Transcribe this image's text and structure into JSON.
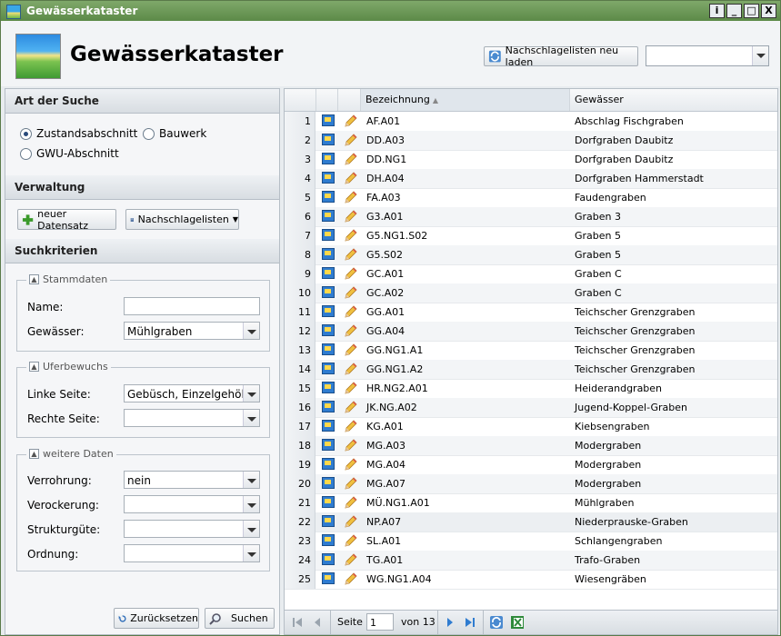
{
  "window": {
    "title": "Gewässerkataster",
    "btn_info": "i",
    "btn_min": "_",
    "btn_max": "□",
    "btn_close": "X"
  },
  "header": {
    "title": "Gewässerkataster",
    "reload_label": "Nachschlagelisten neu laden",
    "combo_value": ""
  },
  "search_type": {
    "title": "Art der Suche",
    "options": [
      "Zustandsabschnitt",
      "Bauwerk",
      "GWU-Abschnitt"
    ],
    "selected": "Zustandsabschnitt"
  },
  "verwaltung": {
    "title": "Verwaltung",
    "new_label": "neuer Datensatz",
    "lists_label": "Nachschlagelisten"
  },
  "criteria": {
    "title": "Suchkriterien",
    "stammdaten": {
      "legend": "Stammdaten",
      "name_label": "Name:",
      "name_value": "",
      "gewaesser_label": "Gewässer:",
      "gewaesser_value": "Mühlgraben"
    },
    "uferbewuchs": {
      "legend": "Uferbewuchs",
      "links_label": "Linke Seite:",
      "links_value": "Gebüsch, Einzelgehölz",
      "rechts_label": "Rechte Seite:",
      "rechts_value": ""
    },
    "weitere": {
      "legend": "weitere Daten",
      "verrohrung_label": "Verrohrung:",
      "verrohrung_value": "nein",
      "verockerung_label": "Verockerung:",
      "verockerung_value": "",
      "strukturguete_label": "Strukturgüte:",
      "strukturguete_value": "",
      "ordnung_label": "Ordnung:",
      "ordnung_value": ""
    },
    "reset_label": "Zurücksetzen",
    "search_label": "Suchen"
  },
  "grid": {
    "columns": {
      "bezeichnung": "Bezeichnung",
      "gewaesser": "Gewässer"
    },
    "rows": [
      {
        "n": "1",
        "bz": "AF.A01",
        "gw": "Abschlag Fischgraben"
      },
      {
        "n": "2",
        "bz": "DD.A03",
        "gw": "Dorfgraben Daubitz"
      },
      {
        "n": "3",
        "bz": "DD.NG1",
        "gw": "Dorfgraben Daubitz"
      },
      {
        "n": "4",
        "bz": "DH.A04",
        "gw": "Dorfgraben Hammerstadt"
      },
      {
        "n": "5",
        "bz": "FA.A03",
        "gw": "Faudengraben"
      },
      {
        "n": "6",
        "bz": "G3.A01",
        "gw": "Graben 3"
      },
      {
        "n": "7",
        "bz": "G5.NG1.S02",
        "gw": "Graben 5"
      },
      {
        "n": "8",
        "bz": "G5.S02",
        "gw": "Graben 5"
      },
      {
        "n": "9",
        "bz": "GC.A01",
        "gw": "Graben C"
      },
      {
        "n": "10",
        "bz": "GC.A02",
        "gw": "Graben C"
      },
      {
        "n": "11",
        "bz": "GG.A01",
        "gw": "Teichscher Grenzgraben"
      },
      {
        "n": "12",
        "bz": "GG.A04",
        "gw": "Teichscher Grenzgraben"
      },
      {
        "n": "13",
        "bz": "GG.NG1.A1",
        "gw": "Teichscher Grenzgraben"
      },
      {
        "n": "14",
        "bz": "GG.NG1.A2",
        "gw": "Teichscher Grenzgraben"
      },
      {
        "n": "15",
        "bz": "HR.NG2.A01",
        "gw": "Heiderandgraben"
      },
      {
        "n": "16",
        "bz": "JK.NG.A02",
        "gw": "Jugend-Koppel-Graben"
      },
      {
        "n": "17",
        "bz": "KG.A01",
        "gw": "Kiebsengraben"
      },
      {
        "n": "18",
        "bz": "MG.A03",
        "gw": "Modergraben"
      },
      {
        "n": "19",
        "bz": "MG.A04",
        "gw": "Modergraben"
      },
      {
        "n": "20",
        "bz": "MG.A07",
        "gw": "Modergraben"
      },
      {
        "n": "21",
        "bz": "MÜ.NG1.A01",
        "gw": "Mühlgraben"
      },
      {
        "n": "22",
        "bz": "NP.A07",
        "gw": "Niederprauske-Graben"
      },
      {
        "n": "23",
        "bz": "SL.A01",
        "gw": "Schlangengraben"
      },
      {
        "n": "24",
        "bz": "TG.A01",
        "gw": "Trafo-Graben"
      },
      {
        "n": "25",
        "bz": "WG.NG1.A04",
        "gw": "Wiesengräben"
      }
    ]
  },
  "pager": {
    "page_label": "Seite",
    "page_value": "1",
    "of_label": "von 13"
  },
  "colors": {
    "title_bar": "#6a9a55",
    "accent": "#2f7cd0"
  }
}
